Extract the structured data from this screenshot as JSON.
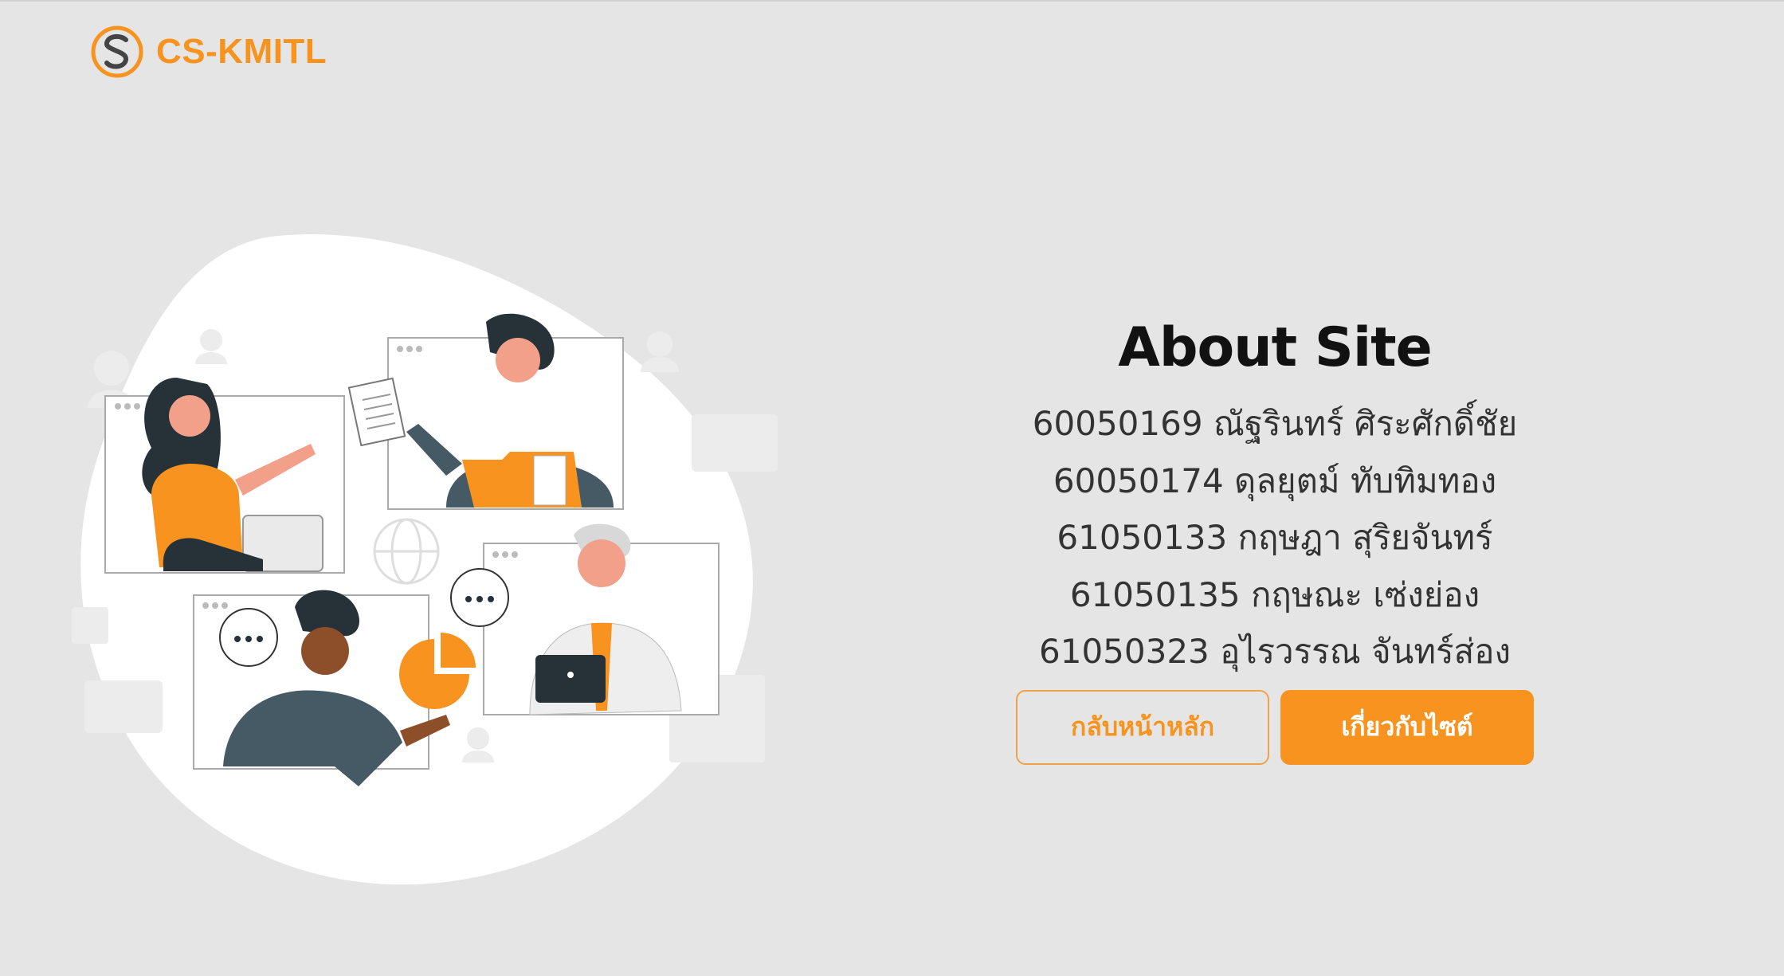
{
  "brand": {
    "name": "CS-KMITL",
    "logo_icon": "s-swirl-logo-icon",
    "color": "#f7931e"
  },
  "about": {
    "title": "About Site",
    "members": [
      "60050169 ณัฐรินทร์ ศิระศักดิ์ชัย",
      "60050174 ดุลยุตม์ ทับทิมทอง",
      "61050133 กฤษฎา สุริยจันทร์",
      "61050135 กฤษณะ เซ่งย่อง",
      "61050323 อุไรวรรณ จันทร์ส่อง"
    ]
  },
  "buttons": {
    "home": "กลับหน้าหลัก",
    "about": "เกี่ยวกับไซต์"
  },
  "illustration": {
    "icon": "remote-team-video-call-illustration"
  }
}
